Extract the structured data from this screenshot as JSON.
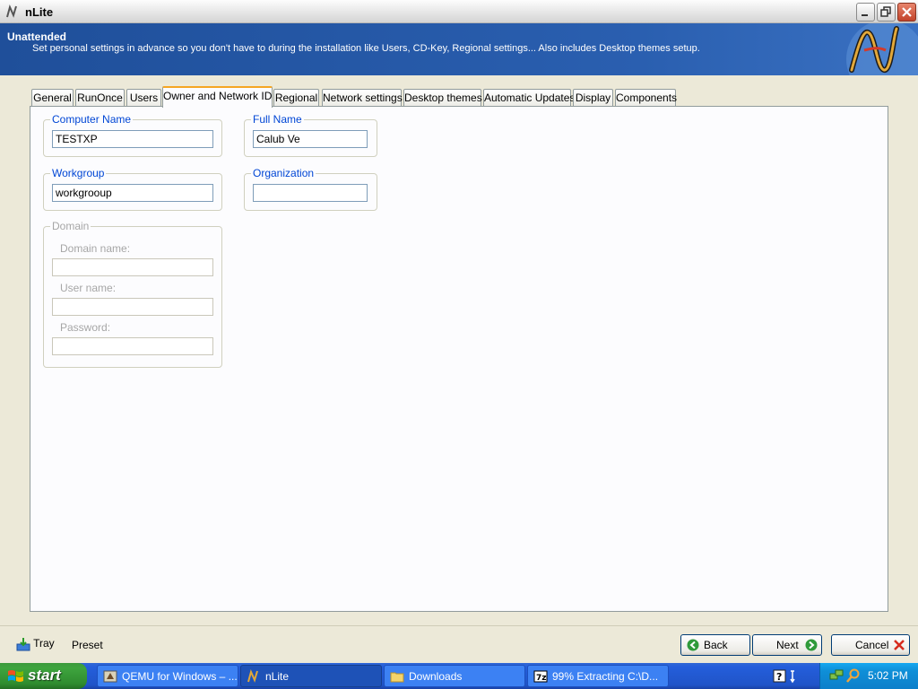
{
  "window": {
    "title": "nLite"
  },
  "header": {
    "title": "Unattended",
    "description": "Set personal settings in advance so you don't have to during the installation like Users, CD-Key, Regional settings... Also includes Desktop themes setup."
  },
  "tabs": [
    {
      "label": "General"
    },
    {
      "label": "RunOnce"
    },
    {
      "label": "Users"
    },
    {
      "label": "Owner and Network ID",
      "active": true
    },
    {
      "label": "Regional"
    },
    {
      "label": "Network settings"
    },
    {
      "label": "Desktop themes"
    },
    {
      "label": "Automatic Updates"
    },
    {
      "label": "Display"
    },
    {
      "label": "Components"
    }
  ],
  "form": {
    "computer_name": {
      "label": "Computer Name",
      "value": "TESTXP"
    },
    "full_name": {
      "label": "Full Name",
      "value": "Calub Ve"
    },
    "workgroup": {
      "label": "Workgroup",
      "value": "workgrooup"
    },
    "organization": {
      "label": "Organization",
      "value": ""
    },
    "domain": {
      "label": "Domain",
      "domain_name_label": "Domain name:",
      "user_name_label": "User name:",
      "password_label": "Password:"
    }
  },
  "bottom": {
    "tray_label": "Tray",
    "preset_label": "Preset",
    "back_label": "Back",
    "next_label": "Next",
    "cancel_label": "Cancel"
  },
  "taskbar": {
    "start_label": "start",
    "tasks": [
      {
        "label": "QEMU for Windows – ..."
      },
      {
        "label": "nLite",
        "active": true
      },
      {
        "label": "Downloads"
      },
      {
        "label": "99% Extracting C:\\D..."
      }
    ],
    "clock": "5:02 PM"
  },
  "colors": {
    "header_bg": "#2a5fb0",
    "legend_text": "#0046d5",
    "active_tab_accent": "#f5a623",
    "taskbar_bg": "#245edb",
    "start_bg": "#3ea43e"
  },
  "icons": [
    "nlite-icon",
    "minimize-icon",
    "maximize-icon",
    "close-icon",
    "nlite-logo",
    "tray-icon",
    "back-arrow-icon",
    "next-arrow-icon",
    "cancel-x-icon",
    "windows-flag-icon",
    "qemu-icon",
    "folder-icon",
    "7zip-icon",
    "help-icon",
    "network-icon",
    "search-icon"
  ]
}
